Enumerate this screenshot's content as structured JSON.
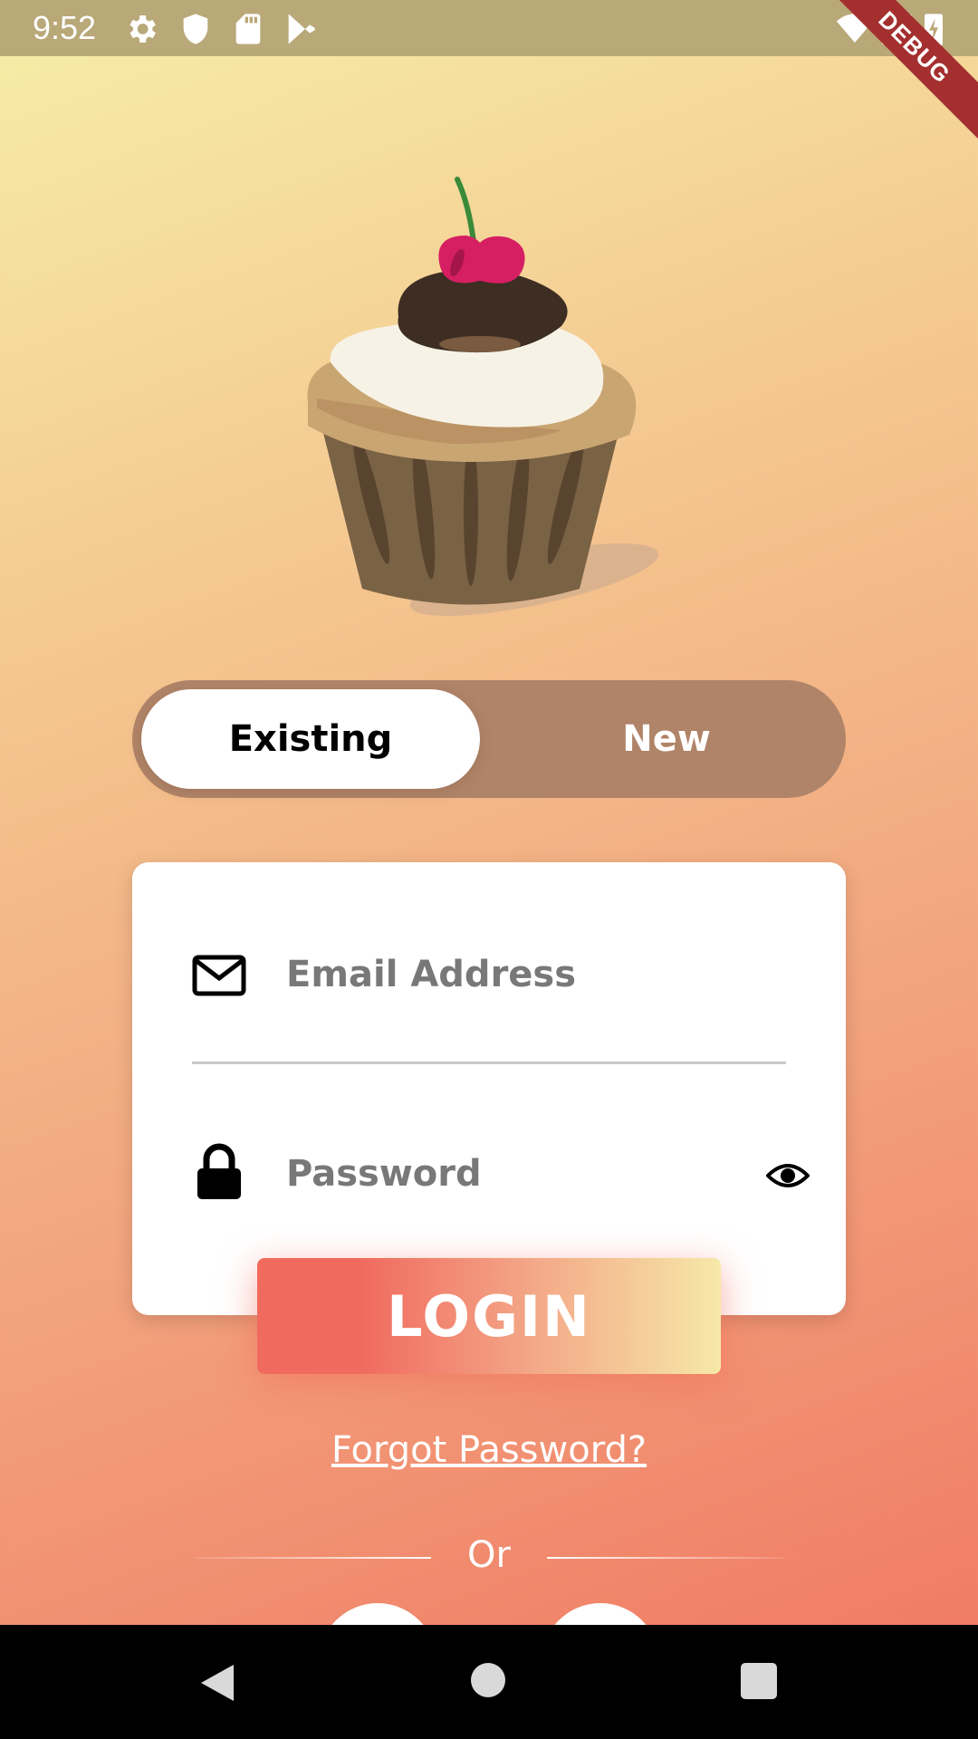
{
  "status_bar": {
    "time": "9:52",
    "icons": [
      "settings-icon",
      "shield-icon",
      "sd-card-icon",
      "play-store-icon",
      "wifi-icon",
      "signal-icon",
      "battery-charging-icon"
    ]
  },
  "debug_banner": {
    "label": "DEBUG"
  },
  "toggle": {
    "existing_label": "Existing",
    "new_label": "New",
    "selected": "Existing"
  },
  "login_form": {
    "email_placeholder": "Email Address",
    "password_placeholder": "Password",
    "login_label": "LOGIN",
    "forgot_label": "Forgot Password?",
    "or_label": "Or"
  },
  "colors": {
    "gradient_top": "#f6eea8",
    "gradient_bottom": "#f07561",
    "toggle_bg": "#b08468",
    "login_red": "#f06a5e",
    "login_yellow": "#f6e9a8"
  }
}
